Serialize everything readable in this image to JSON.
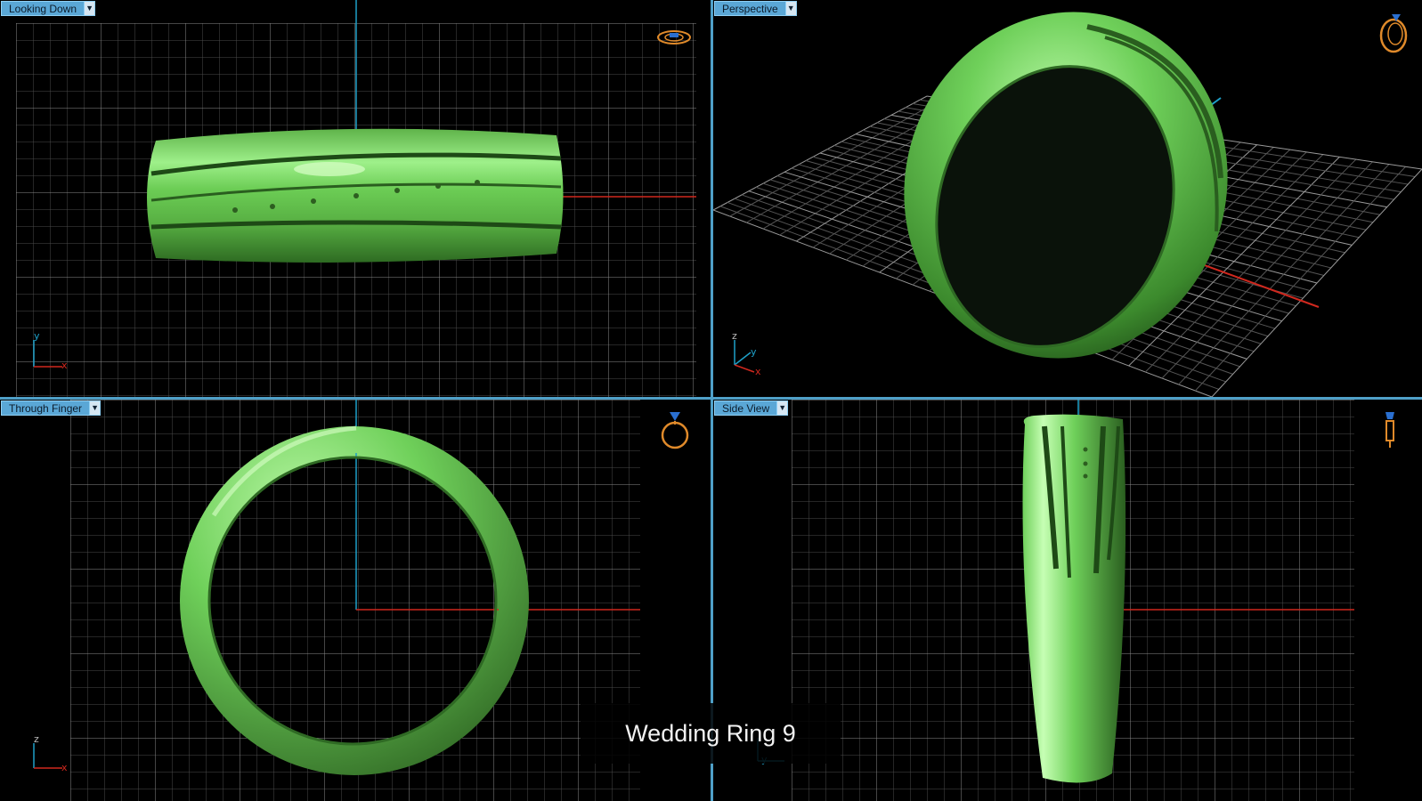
{
  "viewports": {
    "top_left": {
      "label": "Looking Down",
      "axes": [
        "y",
        "x"
      ]
    },
    "top_right": {
      "label": "Perspective",
      "axes": [
        "z",
        "y",
        "x"
      ]
    },
    "bottom_left": {
      "label": "Through Finger",
      "axes": [
        "z",
        "x"
      ]
    },
    "bottom_right": {
      "label": "Side View",
      "axes": [
        "y"
      ]
    }
  },
  "caption": {
    "title": "Wedding Ring 9"
  },
  "icons": {
    "dropdown": "chevron-down-icon",
    "view_cube_top": "ring-top-view-icon",
    "view_cube_persp": "ring-perspective-icon",
    "view_cube_front": "ring-front-view-icon",
    "view_cube_side": "ring-side-view-icon"
  },
  "colors": {
    "grid": "#5a5a5a",
    "grid_bold": "#8a8a8a",
    "axis_x": "#d0281e",
    "axis_y": "#1ea0c8",
    "ring_green": "#6fd05a",
    "label_bg": "#5aa7d6",
    "divider": "#4fa0c8"
  }
}
